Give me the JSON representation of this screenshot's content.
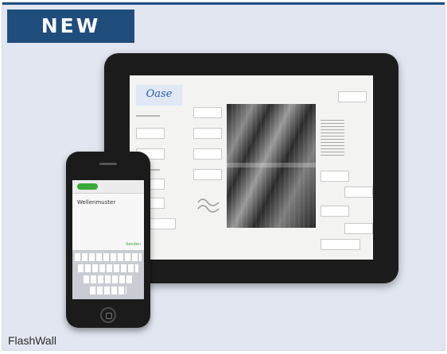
{
  "banner": {
    "label": "NEW"
  },
  "product": {
    "caption": "FlashWall"
  },
  "colors": {
    "banner": "#1f4e7d",
    "panel_background": "#e2e6f0"
  },
  "icons": {
    "tablet_logo": "brand-logo-icon",
    "phone_home": "home-button-icon"
  }
}
